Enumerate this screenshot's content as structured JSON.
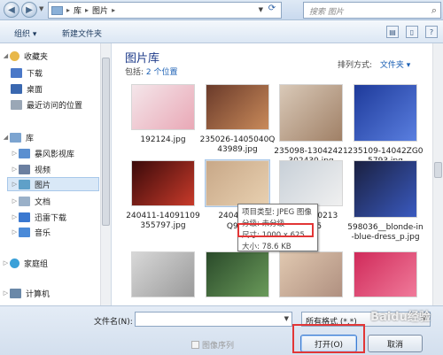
{
  "address": {
    "crumbs": [
      "库",
      "图片"
    ],
    "search_placeholder": "搜索 图片"
  },
  "toolbar": {
    "organize": "组织 ▾",
    "new_folder": "新建文件夹"
  },
  "sidebar": {
    "items": [
      {
        "label": "收藏夹",
        "icon": "star-icon",
        "color": "#e8b84a"
      },
      {
        "label": "下载",
        "icon": "download-folder-icon",
        "color": "#4a78c8"
      },
      {
        "label": "桌面",
        "icon": "desktop-icon",
        "color": "#3a68b0"
      },
      {
        "label": "最近访问的位置",
        "icon": "recent-places-icon",
        "color": "#9aa7b6"
      },
      {
        "label": "库",
        "icon": "library-icon",
        "color": "#7ca4d0"
      },
      {
        "label": "暴风影视库",
        "icon": "media-library-icon",
        "color": "#5b8fd0"
      },
      {
        "label": "视频",
        "icon": "video-library-icon",
        "color": "#6b7fa0"
      },
      {
        "label": "图片",
        "icon": "pictures-library-icon",
        "color": "#5fa0c8"
      },
      {
        "label": "文档",
        "icon": "documents-library-icon",
        "color": "#9ab0c8"
      },
      {
        "label": "迅雷下载",
        "icon": "thunder-download-icon",
        "color": "#3a78d0"
      },
      {
        "label": "音乐",
        "icon": "music-library-icon",
        "color": "#4a8ad8"
      },
      {
        "label": "家庭组",
        "icon": "homegroup-icon",
        "color": "#3aa0d8"
      },
      {
        "label": "计算机",
        "icon": "computer-icon",
        "color": "#6a88a8"
      }
    ]
  },
  "library": {
    "title": "图片库",
    "includes_label": "包括:",
    "includes_link": "2 个位置",
    "arrange_label": "排列方式:",
    "arrange_value": "文件夹 ▾"
  },
  "files": [
    {
      "name": "192124.jpg",
      "colors": [
        "#f4e6ea",
        "#e9a8b6"
      ]
    },
    {
      "name": "235026-1405040Q43989.jpg",
      "colors": [
        "#6a3a2a",
        "#c98a5a"
      ]
    },
    {
      "name": "235098-13042421302430.jpg",
      "colors": [
        "#d9c9b8",
        "#a08066"
      ]
    },
    {
      "name": "235109-14042ZG05793.jpg",
      "colors": [
        "#1e3a9a",
        "#5a7fe0"
      ]
    },
    {
      "name": "240411-14091109355797.jpg",
      "colors": [
        "#3a0a0a",
        "#c83a2a"
      ]
    },
    {
      "name": "240436-1",
      "name2": "Q965",
      "colors": [
        "#c8a888",
        "#e8d0b0"
      ]
    },
    {
      "name": "240436-0213",
      "name2": "Q965",
      "colors": [
        "#c8d0d8",
        "#f0f0f0"
      ]
    },
    {
      "name": "598036__blonde-in-blue-dress_p.jpg",
      "colors": [
        "#1a2040",
        "#3a5ac0"
      ]
    },
    {
      "name": "",
      "colors": [
        "#d8d8d8",
        "#9a9a9a"
      ]
    },
    {
      "name": "",
      "colors": [
        "#2a4a2a",
        "#6a9a5a"
      ]
    },
    {
      "name": "",
      "colors": [
        "#e0c8b0",
        "#b09080"
      ]
    },
    {
      "name": "",
      "colors": [
        "#d02a5a",
        "#f07a9a"
      ]
    }
  ],
  "tooltip": {
    "type": "项目类型: JPEG 图像",
    "rating": "分级: 未分级",
    "dimensions": "尺寸: 1000 x 625",
    "size": "大小: 78.6 KB"
  },
  "bottom": {
    "filename_label": "文件名(N):",
    "filename_value": "",
    "filter_value": "所有格式 (*.*)",
    "sequence_label": "图像序列",
    "open_label": "打开(O)",
    "cancel_label": "取消"
  },
  "watermark": "Baidu经验"
}
